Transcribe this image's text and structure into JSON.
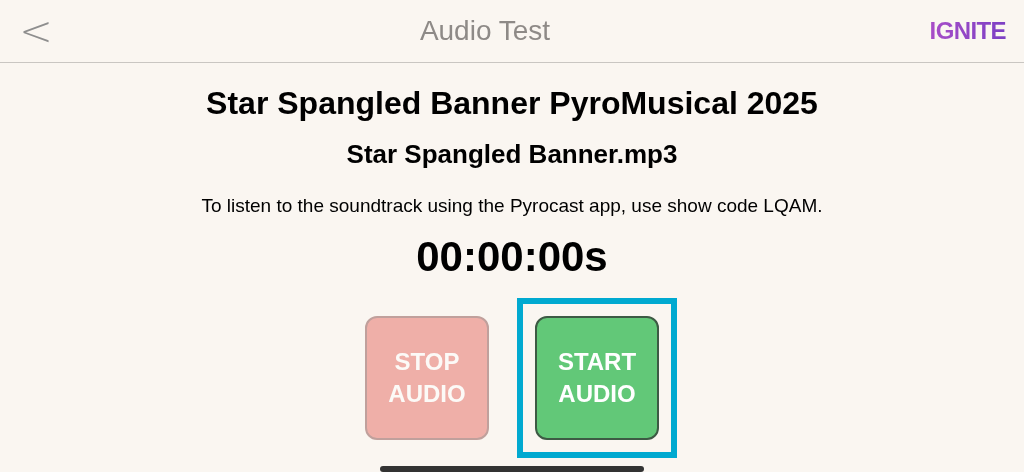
{
  "header": {
    "back": "<",
    "title": "Audio Test",
    "logo": "IGNITE"
  },
  "show_title": "Star Spangled Banner PyroMusical 2025",
  "file_name": "Star Spangled Banner.mp3",
  "instructions": "To listen to the soundtrack using the Pyrocast app, use show code LQAM.",
  "timer": "00:00:00s",
  "buttons": [
    {
      "kind": "stop",
      "lines": [
        "STOP",
        "AUDIO"
      ],
      "disabled": true,
      "focused": false
    },
    {
      "kind": "start",
      "lines": [
        "START",
        "AUDIO"
      ],
      "disabled": false,
      "focused": true
    }
  ]
}
